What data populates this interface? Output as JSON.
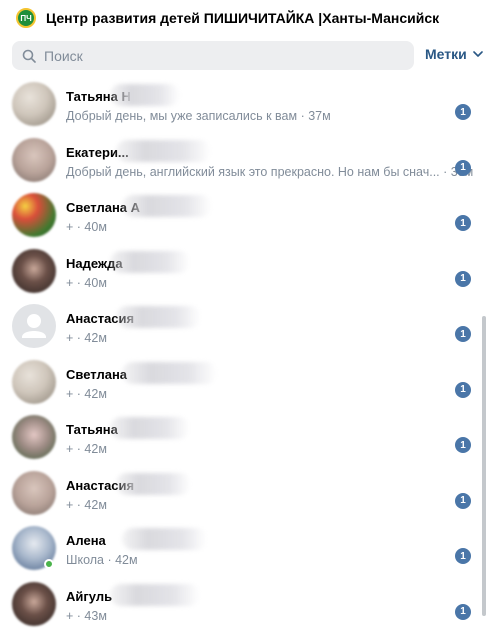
{
  "header": {
    "logo_text": "ПЧ",
    "title": "Центр развития детей ПИШИЧИТАЙКА |Ханты-Мансийск"
  },
  "search": {
    "placeholder": "Поиск",
    "value": ""
  },
  "labels_button": {
    "label": "Метки"
  },
  "conversations": [
    {
      "name": "Татьяна Н",
      "message": "Добрый день, мы уже записались к вам",
      "time": "37м",
      "unread": "1",
      "avatar": "photo-light"
    },
    {
      "name": "Екатери...",
      "message": "Добрый день, английский язык это прекрасно. Но нам бы снач...",
      "time": "39м",
      "unread": "1",
      "avatar": "photo-blur"
    },
    {
      "name": "Светлана А",
      "message": "+",
      "time": "40м",
      "unread": "1",
      "avatar": "photo-flowers"
    },
    {
      "name": "Надежда",
      "message": "+",
      "time": "40м",
      "unread": "1",
      "avatar": "photo-dark"
    },
    {
      "name": "Анастасия",
      "message": "+",
      "time": "42м",
      "unread": "1",
      "avatar": "default-user"
    },
    {
      "name": "Светлана",
      "message": "+",
      "time": "42м",
      "unread": "1",
      "avatar": "photo-light"
    },
    {
      "name": "Татьяна",
      "message": "+",
      "time": "42м",
      "unread": "1",
      "avatar": "photo-green"
    },
    {
      "name": "Анастасия",
      "message": "+",
      "time": "42м",
      "unread": "1",
      "avatar": "photo-blur"
    },
    {
      "name": "Алена",
      "message": "Школа",
      "time": "42м",
      "unread": "1",
      "avatar": "photo-blue",
      "online": true
    },
    {
      "name": "Айгуль",
      "message": "+",
      "time": "43м",
      "unread": "1",
      "avatar": "photo-dark"
    }
  ],
  "colors": {
    "accent": "#2a5885",
    "badge": "#4a76a8",
    "muted": "#818c99",
    "search_bg": "#edeef0",
    "online": "#4bb34b"
  }
}
